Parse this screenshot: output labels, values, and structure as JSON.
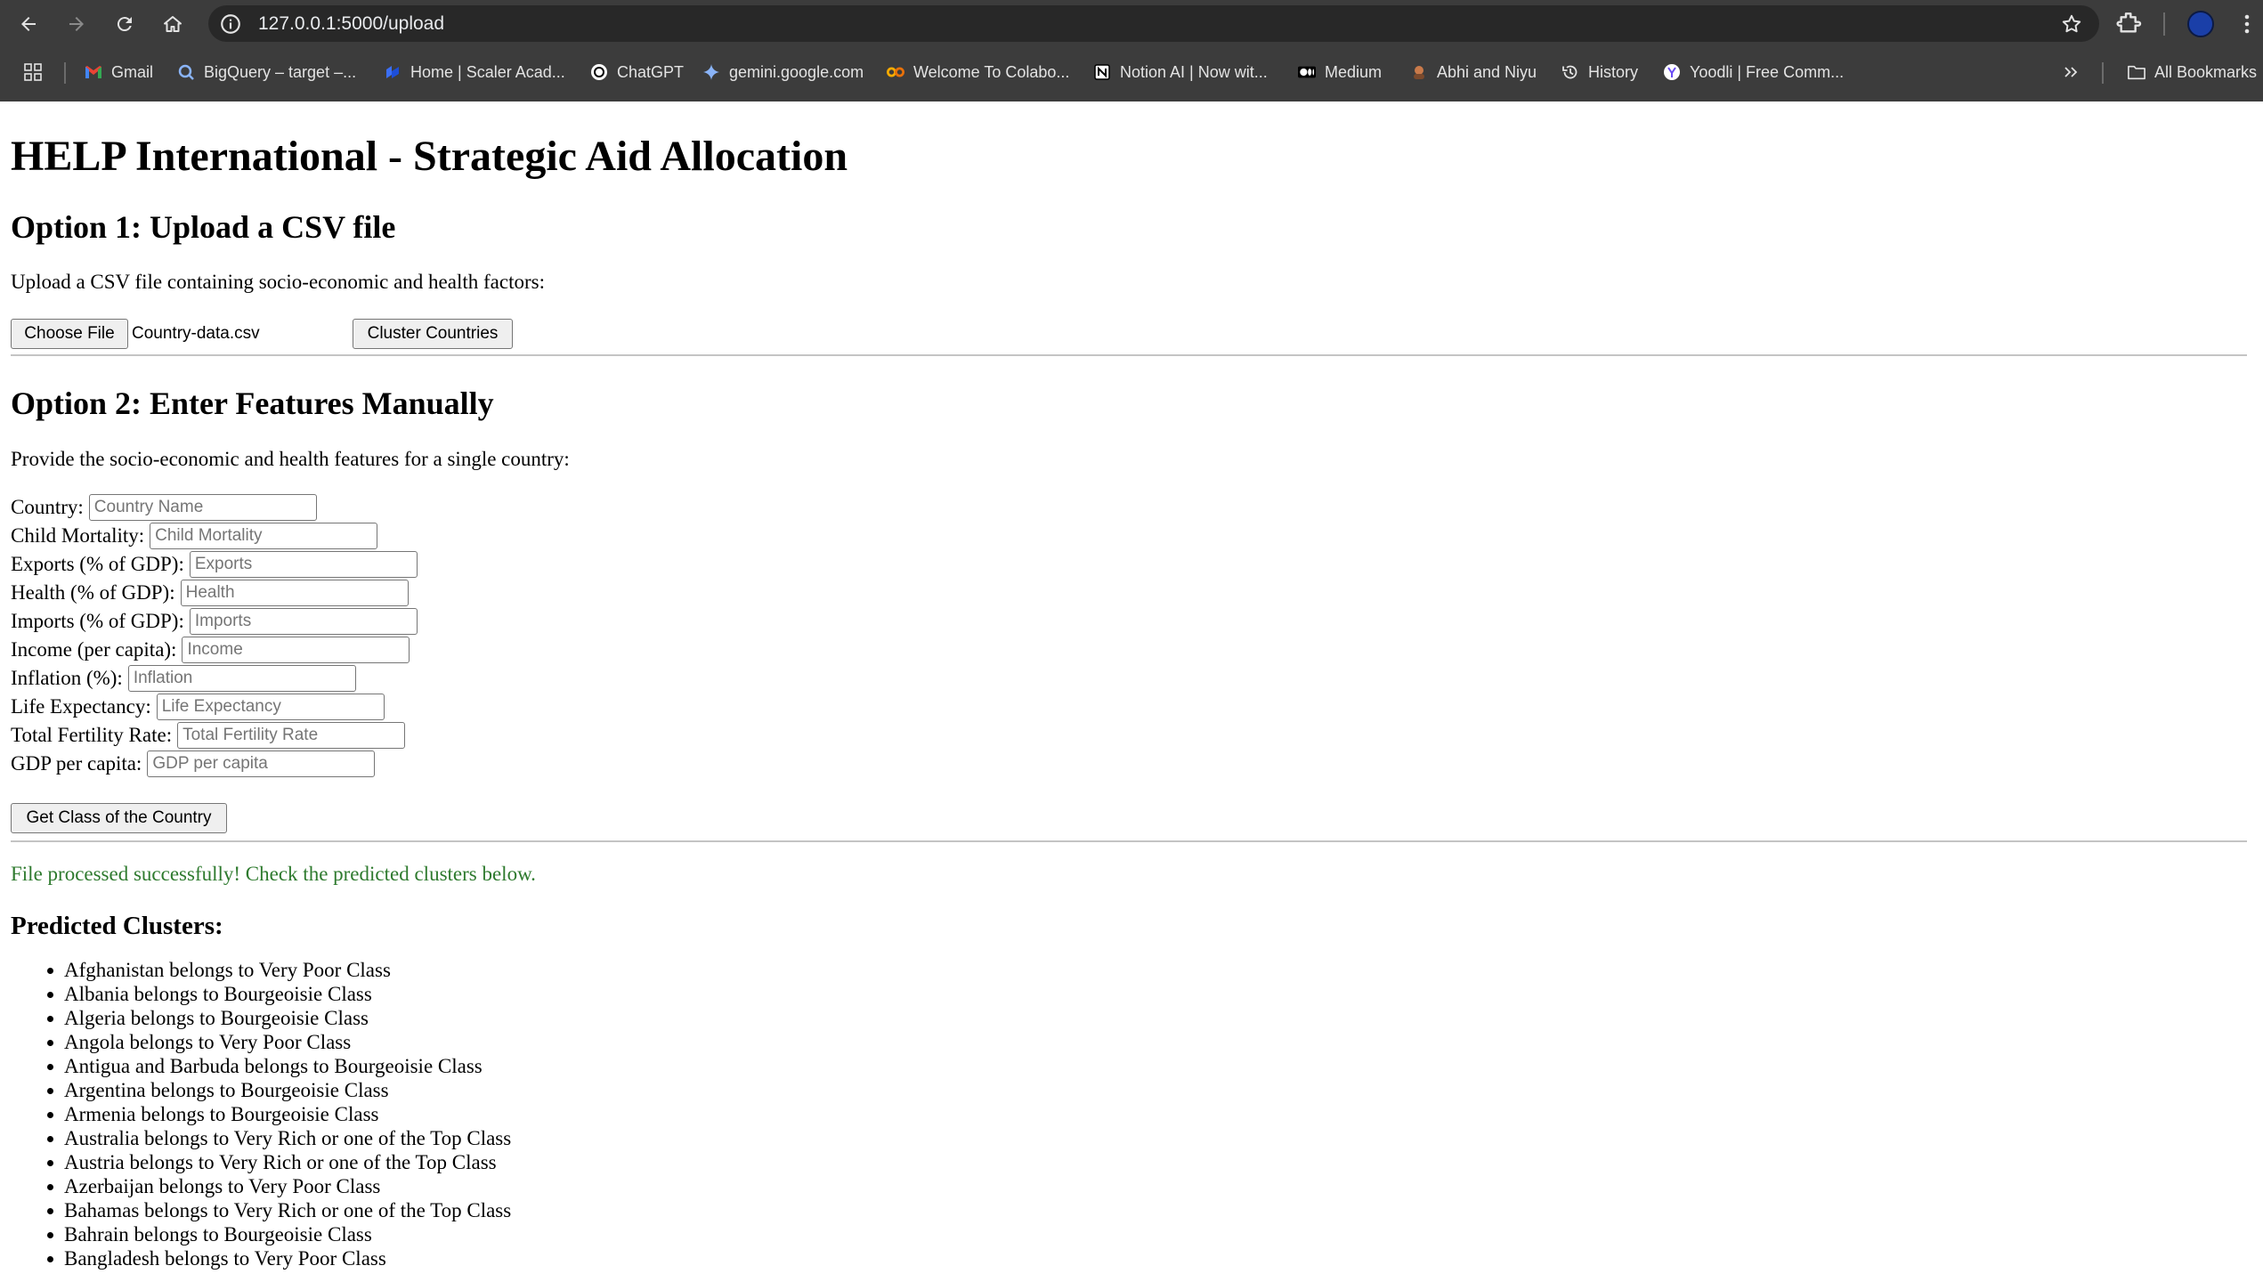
{
  "browser": {
    "url": "127.0.0.1:5000/upload",
    "bookmarks": [
      {
        "label": "Gmail",
        "icon": "gmail-icon"
      },
      {
        "label": "BigQuery – target –...",
        "icon": "bigquery-icon"
      },
      {
        "label": "Home | Scaler Acad...",
        "icon": "scaler-icon"
      },
      {
        "label": "ChatGPT",
        "icon": "chatgpt-icon"
      },
      {
        "label": "gemini.google.com",
        "icon": "gemini-icon"
      },
      {
        "label": "Welcome To Colabo...",
        "icon": "colab-icon"
      },
      {
        "label": "Notion AI | Now wit...",
        "icon": "notion-icon"
      },
      {
        "label": "Medium",
        "icon": "medium-icon"
      },
      {
        "label": "Abhi and Niyu",
        "icon": "photo-icon"
      },
      {
        "label": "History",
        "icon": "history-icon"
      },
      {
        "label": "Yoodli | Free Comm...",
        "icon": "yoodli-icon"
      }
    ],
    "all_bookmarks": "All Bookmarks"
  },
  "page": {
    "title": "HELP International - Strategic Aid Allocation",
    "option1": {
      "heading": "Option 1: Upload a CSV file",
      "description": "Upload a CSV file containing socio-economic and health factors:",
      "choose_file_label": "Choose File",
      "file_name": "Country-data.csv",
      "submit_label": "Cluster Countries"
    },
    "option2": {
      "heading": "Option 2: Enter Features Manually",
      "description": "Provide the socio-economic and health features for a single country:",
      "fields": [
        {
          "label": "Country:",
          "placeholder": "Country Name"
        },
        {
          "label": "Child Mortality:",
          "placeholder": "Child Mortality"
        },
        {
          "label": "Exports (% of GDP):",
          "placeholder": "Exports"
        },
        {
          "label": "Health (% of GDP):",
          "placeholder": "Health"
        },
        {
          "label": "Imports (% of GDP):",
          "placeholder": "Imports"
        },
        {
          "label": "Income (per capita):",
          "placeholder": "Income"
        },
        {
          "label": "Inflation (%):",
          "placeholder": "Inflation"
        },
        {
          "label": "Life Expectancy:",
          "placeholder": "Life Expectancy"
        },
        {
          "label": "Total Fertility Rate:",
          "placeholder": "Total Fertility Rate"
        },
        {
          "label": "GDP per capita:",
          "placeholder": "GDP per capita"
        }
      ],
      "submit_label": "Get Class of the Country"
    },
    "success_message": "File processed successfully! Check the predicted clusters below.",
    "results_heading": "Predicted Clusters:",
    "results": [
      "Afghanistan belongs to Very Poor Class",
      "Albania belongs to Bourgeoisie Class",
      "Algeria belongs to Bourgeoisie Class",
      "Angola belongs to Very Poor Class",
      "Antigua and Barbuda belongs to Bourgeoisie Class",
      "Argentina belongs to Bourgeoisie Class",
      "Armenia belongs to Bourgeoisie Class",
      "Australia belongs to Very Rich or one of the Top Class",
      "Austria belongs to Very Rich or one of the Top Class",
      "Azerbaijan belongs to Very Poor Class",
      "Bahamas belongs to Very Rich or one of the Top Class",
      "Bahrain belongs to Bourgeoisie Class",
      "Bangladesh belongs to Very Poor Class"
    ]
  }
}
